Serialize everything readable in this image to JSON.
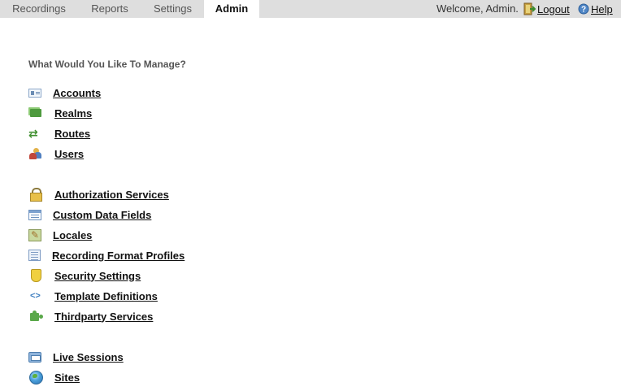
{
  "tabs": [
    {
      "label": "Recordings"
    },
    {
      "label": "Reports"
    },
    {
      "label": "Settings"
    },
    {
      "label": "Admin"
    }
  ],
  "header": {
    "welcome": "Welcome, Admin.",
    "logout_label": "Logout",
    "help_label": "Help"
  },
  "main": {
    "heading": "What Would You Like To Manage?",
    "groups": [
      {
        "items": [
          {
            "label": "Accounts",
            "icon": "accounts-card-icon"
          },
          {
            "label": "Realms",
            "icon": "realms-icon"
          },
          {
            "label": "Routes",
            "icon": "routes-arrows-icon"
          },
          {
            "label": "Users",
            "icon": "users-icon"
          }
        ]
      },
      {
        "items": [
          {
            "label": "Authorization Services",
            "icon": "lock-icon"
          },
          {
            "label": "Custom Data Fields",
            "icon": "form-fields-icon"
          },
          {
            "label": "Locales",
            "icon": "locale-icon"
          },
          {
            "label": "Recording Format Profiles",
            "icon": "format-list-icon"
          },
          {
            "label": "Security Settings",
            "icon": "shield-icon"
          },
          {
            "label": "Template Definitions",
            "icon": "code-brackets-icon"
          },
          {
            "label": "Thirdparty Services",
            "icon": "puzzle-piece-icon"
          }
        ]
      },
      {
        "items": [
          {
            "label": "Live Sessions",
            "icon": "live-sessions-icon"
          },
          {
            "label": "Sites",
            "icon": "globe-icon"
          }
        ]
      }
    ]
  }
}
